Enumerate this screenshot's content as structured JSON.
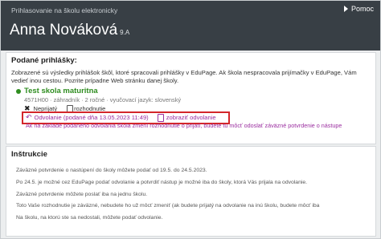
{
  "header": {
    "subtitle": "Prihlasovanie na školu elektronicky",
    "name": "Anna Nováková",
    "class": "9.A",
    "help": "Pomoc"
  },
  "applications": {
    "title": "Podané prihlášky:",
    "intro": "Zobrazené sú výsledky prihlášok škôl, ktoré spracovali prihlášky v EduPage. Ak škola nespracovala prijímačky v EduPage, Vám vedieť inou cestou. Pozrite prípadne Web stránku danej školy.",
    "school_name": "Test skola maturitna",
    "school_meta": "4571H00 · záhradník · 2 ročné · vyučovací jazyk: slovenský",
    "status_text": "Neprijatý",
    "decision_link": "rozhodnutie",
    "appeal_text": "Odvolanie (podané dňa 13.05.2023 11:49)",
    "appeal_link": "zobraziť odvolanie",
    "note": "Ak na základe podaného odvolania škola zmení rozhodnutie o prijatí, budete tu môcť odoslať záväzné potvrdenie o nástupe"
  },
  "instructions": {
    "title": "Inštrukcie",
    "items": [
      "Záväzné potvrdenie o nastúpení do školy môžete podať od 19.5. do 24.5.2023.",
      "Po 24.5. je možné cez EduPage podať odvolanie a potvrdiť nástup je možné iba do školy, ktorá Vás prijala na odvolanie.",
      "Záväzné potvrdenie môžete poslať iba na jednu školu.",
      "Toto Vaše rozhodnutie je záväzné, nebudete ho už môcť zmeniť (ak budete prijatý na odvolanie na inú školu, budete môcť iba",
      "Na školu, na ktorú ste sa nedostali, môžete podať odvolanie."
    ]
  },
  "colors": {
    "header_bg": "#383f45",
    "accent_green": "#2f8d20",
    "accent_purple": "#9b2fa0",
    "highlight_red": "#d3262b"
  }
}
